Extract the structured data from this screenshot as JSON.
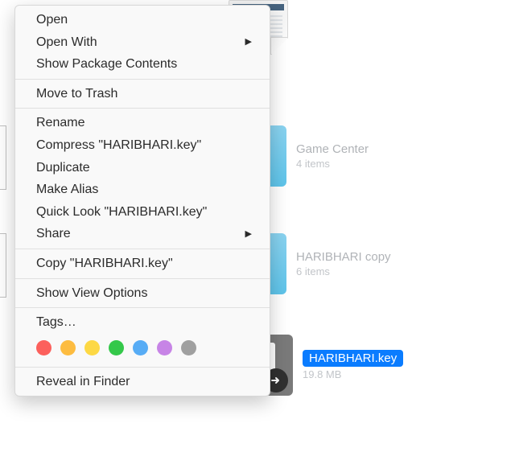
{
  "menu": {
    "items": [
      {
        "label": "Open",
        "submenu": false
      },
      {
        "label": "Open With",
        "submenu": true
      },
      {
        "label": "Show Package Contents",
        "submenu": false
      },
      "---",
      {
        "label": "Move to Trash",
        "submenu": false
      },
      "---",
      {
        "label": "Rename",
        "submenu": false
      },
      {
        "label": "Compress \"HARIBHARI.key\"",
        "submenu": false
      },
      {
        "label": "Duplicate",
        "submenu": false
      },
      {
        "label": "Make Alias",
        "submenu": false
      },
      {
        "label": "Quick Look \"HARIBHARI.key\"",
        "submenu": false
      },
      {
        "label": "Share",
        "submenu": true
      },
      "---",
      {
        "label": "Copy \"HARIBHARI.key\"",
        "submenu": false
      },
      "---",
      {
        "label": "Show View Options",
        "submenu": false
      },
      "---",
      {
        "label": "Tags…",
        "submenu": false
      },
      "TAGS",
      "---",
      {
        "label": "Reveal in Finder",
        "submenu": false
      }
    ],
    "tag_colors": [
      "#fc605c",
      "#fdbc40",
      "#fdd844",
      "#34c84a",
      "#57acf5",
      "#c784e6",
      "#a0a0a0"
    ]
  },
  "bg": {
    "game_center": {
      "label": "Game Center",
      "sub": "4 items"
    },
    "haribhari_copy": {
      "label": "HARIBHARI copy",
      "sub": "6 items"
    },
    "haribhari_key": {
      "label": "HARIBHARI.key",
      "sub": "19.8 MB"
    }
  }
}
